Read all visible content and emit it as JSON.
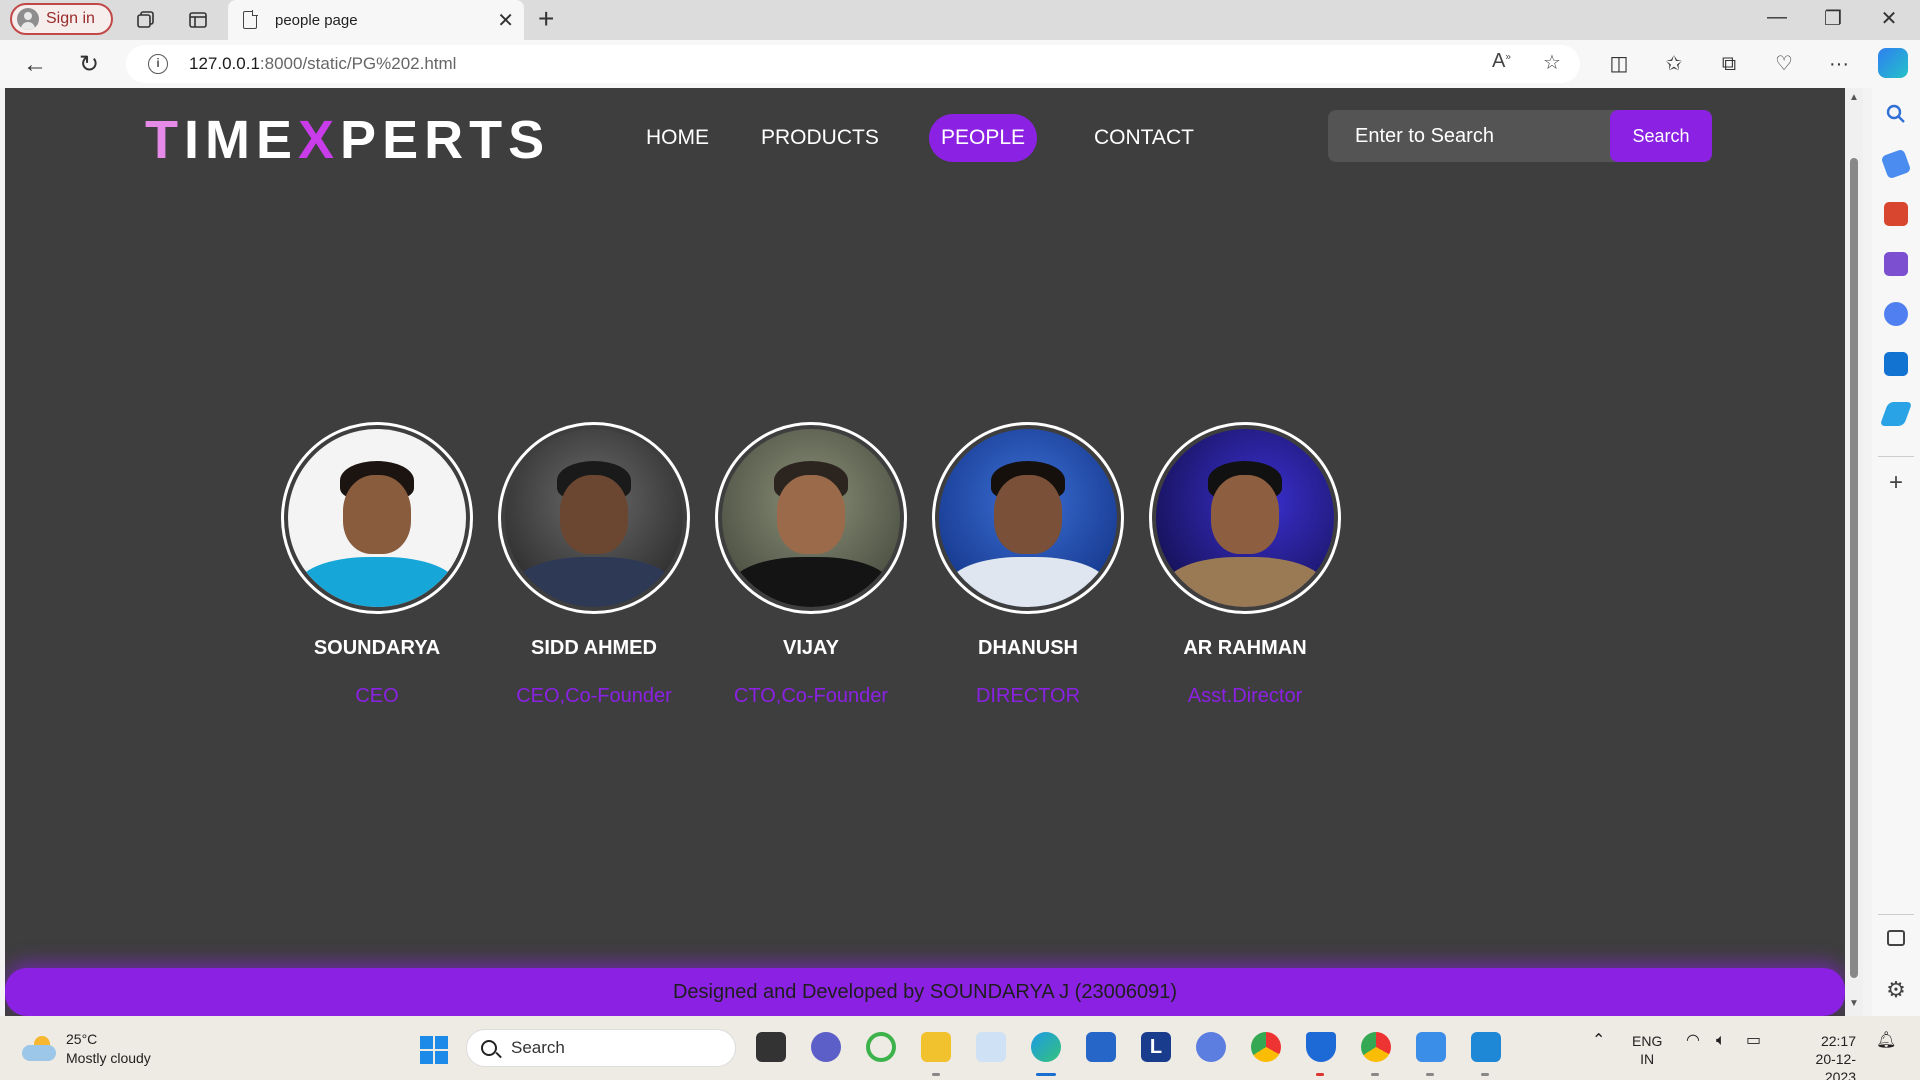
{
  "browser": {
    "signin_label": "Sign in",
    "tab_title": "people page",
    "url_host": "127.0.0.1",
    "url_rest": ":8000/static/PG%202.html"
  },
  "site": {
    "logo": {
      "part1": "T",
      "part2": "IME",
      "part3": "X",
      "part4": "PERTS"
    },
    "nav": {
      "home": "HOME",
      "products": "PRODUCTS",
      "people": "PEOPLE",
      "contact": "CONTACT"
    },
    "search": {
      "placeholder": "Enter to Search",
      "button": "Search"
    },
    "people": [
      {
        "name": "SOUNDARYA",
        "role": "CEO"
      },
      {
        "name": "SIDD AHMED",
        "role": "CEO,Co-Founder"
      },
      {
        "name": "VIJAY",
        "role": "CTO,Co-Founder"
      },
      {
        "name": "DHANUSH",
        "role": "DIRECTOR"
      },
      {
        "name": "AR RAHMAN",
        "role": "Asst.Director"
      }
    ],
    "footer": "Designed and Developed by SOUNDARYA J (23006091)"
  },
  "taskbar": {
    "weather_temp": "25°C",
    "weather_desc": "Mostly cloudy",
    "search_label": "Search",
    "lang1": "ENG",
    "lang2": "IN",
    "time": "22:17",
    "date": "20-12-2023"
  },
  "colors": {
    "accent": "#8b21e3",
    "page_bg": "#3e3e3e",
    "logo_pink": "#e58ae6"
  }
}
